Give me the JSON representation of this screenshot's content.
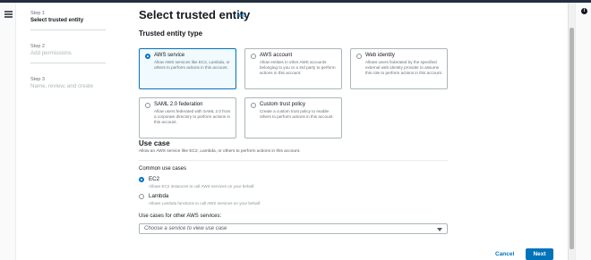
{
  "steps": [
    {
      "number": "Step 1",
      "title": "Select trusted entity"
    },
    {
      "number": "Step 2",
      "title": "Add permissions"
    },
    {
      "number": "Step 3",
      "title": "Name, review, and create"
    }
  ],
  "header": {
    "title": "Select trusted entity",
    "info_link": "Info"
  },
  "trusted_entity_type": {
    "heading": "Trusted entity type",
    "options": [
      {
        "title": "AWS service",
        "description": "Allow AWS services like EC2, Lambda, or others to perform actions in this account.",
        "selected": true
      },
      {
        "title": "AWS account",
        "description": "Allow entities in other AWS accounts belonging to you or a 3rd party to perform actions in this account.",
        "selected": false
      },
      {
        "title": "Web identity",
        "description": "Allows users federated by the specified external web identity provider to assume this role to perform actions in this account.",
        "selected": false
      },
      {
        "title": "SAML 2.0 federation",
        "description": "Allow users federated with SAML 2.0 from a corporate directory to perform actions in this account.",
        "selected": false
      },
      {
        "title": "Custom trust policy",
        "description": "Create a custom trust policy to enable others to perform actions in this account.",
        "selected": false
      }
    ]
  },
  "use_case": {
    "heading": "Use case",
    "description": "Allow an AWS service like EC2, Lambda, or others to perform actions in this account.",
    "common_label": "Common use cases",
    "options": [
      {
        "title": "EC2",
        "description": "Allows EC2 instances to call AWS services on your behalf.",
        "selected": true
      },
      {
        "title": "Lambda",
        "description": "Allows Lambda functions to call AWS services on your behalf.",
        "selected": false
      }
    ],
    "other_label": "Use cases for other AWS services:",
    "select_placeholder": "Choose a service to view use case"
  },
  "footer": {
    "cancel_label": "Cancel",
    "next_label": "Next"
  },
  "icons": {
    "menu": "hamburger-menu-icon",
    "info": "info-icon",
    "dropdown": "caret-down-icon"
  },
  "colors": {
    "accent": "#0073bb",
    "topbar": "#232f3e",
    "selected_card_bg": "#f1faff"
  }
}
